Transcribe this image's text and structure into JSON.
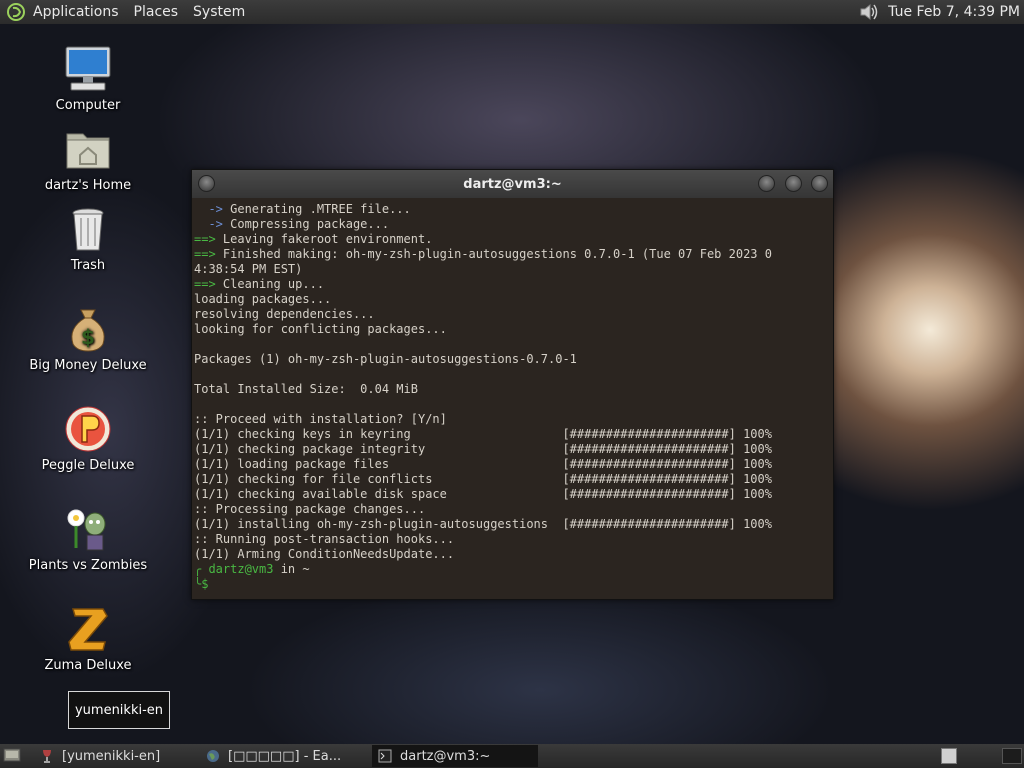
{
  "top_panel": {
    "menus": [
      "Applications",
      "Places",
      "System"
    ],
    "clock": "Tue Feb  7,  4:39 PM",
    "icons": {
      "logo": "gnome-foot-icon",
      "volume": "speaker-icon"
    }
  },
  "desktop": {
    "icons": [
      {
        "label": "Computer",
        "icon": "computer-icon"
      },
      {
        "label": "dartz's Home",
        "icon": "home-folder-icon"
      },
      {
        "label": "Trash",
        "icon": "trash-icon"
      },
      {
        "label": "Big Money Deluxe",
        "icon": "money-bag-icon"
      },
      {
        "label": "Peggle Deluxe",
        "icon": "peggle-icon"
      },
      {
        "label": "Plants vs Zombies",
        "icon": "plants-vs-zombies-icon"
      },
      {
        "label": "Zuma Deluxe",
        "icon": "zuma-icon"
      }
    ],
    "selected_item": "yumenikki-en"
  },
  "terminal": {
    "title": "dartz@vm3:~",
    "lines": [
      {
        "pre": "  -> ",
        "text": "Generating .MTREE file...",
        "style": "blue-arrow"
      },
      {
        "pre": "  -> ",
        "text": "Compressing package...",
        "style": "blue-arrow"
      },
      {
        "pre": "==> ",
        "text": "Leaving fakeroot environment.",
        "style": "green-arrow"
      },
      {
        "pre": "==> ",
        "text": "Finished making: oh-my-zsh-plugin-autosuggestions 0.7.0-1 (Tue 07 Feb 2023 0",
        "style": "green-arrow"
      },
      {
        "pre": "",
        "text": "4:38:54 PM EST)",
        "style": "plain"
      },
      {
        "pre": "==> ",
        "text": "Cleaning up...",
        "style": "green-arrow"
      },
      {
        "pre": "",
        "text": "loading packages...",
        "style": "plain"
      },
      {
        "pre": "",
        "text": "resolving dependencies...",
        "style": "plain"
      },
      {
        "pre": "",
        "text": "looking for conflicting packages...",
        "style": "plain"
      },
      {
        "pre": "",
        "text": "",
        "style": "plain"
      },
      {
        "pre": "",
        "text": "Packages (1) oh-my-zsh-plugin-autosuggestions-0.7.0-1",
        "style": "plain"
      },
      {
        "pre": "",
        "text": "",
        "style": "plain"
      },
      {
        "pre": "",
        "text": "Total Installed Size:  0.04 MiB",
        "style": "plain"
      },
      {
        "pre": "",
        "text": "",
        "style": "plain"
      },
      {
        "pre": "",
        "text": ":: Proceed with installation? [Y/n]",
        "style": "plain"
      },
      {
        "pre": "",
        "text": "(1/1) checking keys in keyring                     [######################] 100%",
        "style": "plain"
      },
      {
        "pre": "",
        "text": "(1/1) checking package integrity                   [######################] 100%",
        "style": "plain"
      },
      {
        "pre": "",
        "text": "(1/1) loading package files                        [######################] 100%",
        "style": "plain"
      },
      {
        "pre": "",
        "text": "(1/1) checking for file conflicts                  [######################] 100%",
        "style": "plain"
      },
      {
        "pre": "",
        "text": "(1/1) checking available disk space                [######################] 100%",
        "style": "plain"
      },
      {
        "pre": "",
        "text": ":: Processing package changes...",
        "style": "plain"
      },
      {
        "pre": "",
        "text": "(1/1) installing oh-my-zsh-plugin-autosuggestions  [######################] 100%",
        "style": "plain"
      },
      {
        "pre": "",
        "text": ":: Running post-transaction hooks...",
        "style": "plain"
      },
      {
        "pre": "",
        "text": "(1/1) Arming ConditionNeedsUpdate...",
        "style": "plain"
      }
    ],
    "prompt_user": "dartz@vm3",
    "prompt_in": " in ",
    "prompt_dir": "~",
    "prompt_symbol": "$"
  },
  "taskbar": {
    "tasks": [
      {
        "label": "[yumenikki-en]",
        "icon": "wine-icon",
        "active": false
      },
      {
        "label": "[□□□□□] - Ea...",
        "icon": "earth-icon",
        "active": false
      },
      {
        "label": "dartz@vm3:~",
        "icon": "terminal-icon",
        "active": true
      }
    ],
    "icons": {
      "show_desktop": "show-desktop-icon",
      "workspace": "workspace-icon"
    }
  }
}
